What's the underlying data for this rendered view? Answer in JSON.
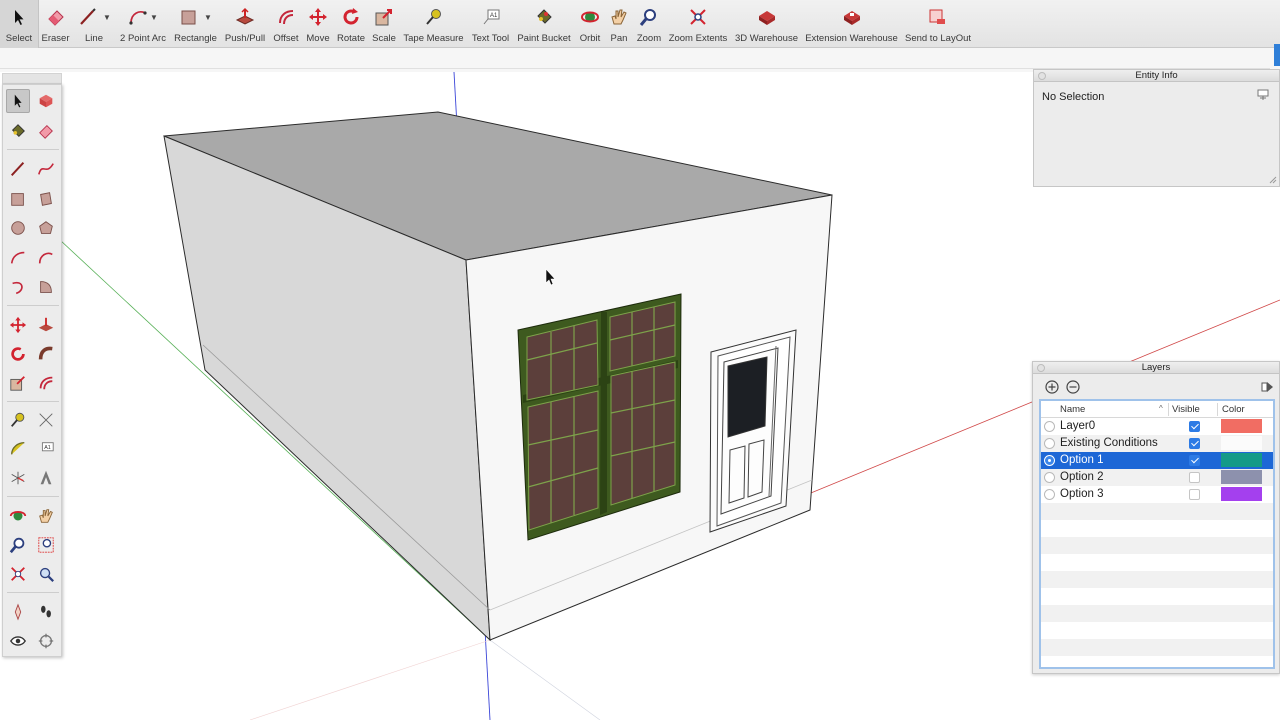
{
  "toolbar": {
    "tools": [
      {
        "label": "Select",
        "icon": "select-arrow-icon"
      },
      {
        "label": "Eraser",
        "icon": "eraser-icon"
      },
      {
        "label": "Line",
        "icon": "pencil-line-icon"
      },
      {
        "label": "2 Point Arc",
        "icon": "arc-icon"
      },
      {
        "label": "Rectangle",
        "icon": "rectangle-icon"
      },
      {
        "label": "Push/Pull",
        "icon": "push-pull-icon"
      },
      {
        "label": "Offset",
        "icon": "offset-icon"
      },
      {
        "label": "Move",
        "icon": "move-icon"
      },
      {
        "label": "Rotate",
        "icon": "rotate-icon"
      },
      {
        "label": "Scale",
        "icon": "scale-icon"
      },
      {
        "label": "Tape Measure",
        "icon": "tape-measure-icon"
      },
      {
        "label": "Text Tool",
        "icon": "text-tool-icon"
      },
      {
        "label": "Paint Bucket",
        "icon": "paint-bucket-icon"
      },
      {
        "label": "Orbit",
        "icon": "orbit-icon"
      },
      {
        "label": "Pan",
        "icon": "pan-hand-icon"
      },
      {
        "label": "Zoom",
        "icon": "zoom-icon"
      },
      {
        "label": "Zoom Extents",
        "icon": "zoom-extents-icon"
      },
      {
        "label": "3D Warehouse",
        "icon": "3d-warehouse-icon"
      },
      {
        "label": "Extension Warehouse",
        "icon": "extension-warehouse-icon"
      },
      {
        "label": "Send to LayOut",
        "icon": "send-to-layout-icon"
      }
    ]
  },
  "entity_info": {
    "title": "Entity Info",
    "selection": "No Selection"
  },
  "layers": {
    "title": "Layers",
    "columns": {
      "name": "Name",
      "visible": "Visible",
      "color": "Color"
    },
    "rows": [
      {
        "name": "Layer0",
        "active": false,
        "visible": true,
        "color": "#f16d63",
        "selected": false
      },
      {
        "name": "Existing Conditions",
        "active": false,
        "visible": true,
        "color": "#fbfbfb",
        "selected": false
      },
      {
        "name": "Option 1",
        "active": true,
        "visible": true,
        "color": "#149a88",
        "selected": true
      },
      {
        "name": "Option 2",
        "active": false,
        "visible": false,
        "color": "#8d91ad",
        "selected": false
      },
      {
        "name": "Option 3",
        "active": false,
        "visible": false,
        "color": "#a440ee",
        "selected": false
      }
    ]
  },
  "colors": {
    "selection_blue": "#1d67d6",
    "window_frame_green": "#3e5a1f",
    "glass_dark": "#1c1f24"
  }
}
